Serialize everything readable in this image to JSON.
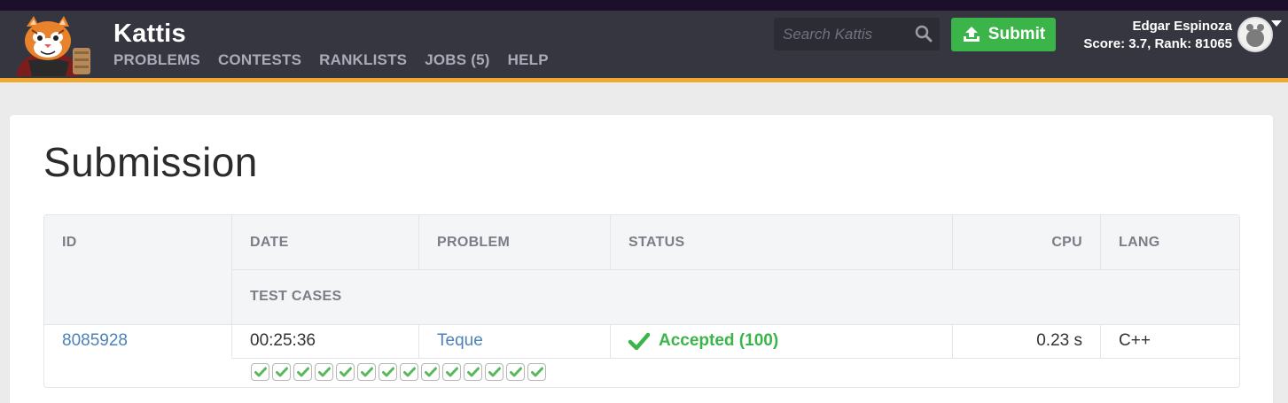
{
  "app": {
    "brand": "Kattis",
    "nav": [
      "PROBLEMS",
      "CONTESTS",
      "RANKLISTS",
      "JOBS (5)",
      "HELP"
    ],
    "search_placeholder": "Search Kattis",
    "submit_label": "Submit",
    "user_name": "Edgar Espinoza",
    "user_stats": "Score: 3.7, Rank: 81065"
  },
  "page": {
    "title": "Submission"
  },
  "table": {
    "headers": {
      "id": "ID",
      "date": "DATE",
      "problem": "PROBLEM",
      "status": "STATUS",
      "cpu": "CPU",
      "lang": "LANG",
      "test_cases": "TEST CASES"
    },
    "row": {
      "id": "8085928",
      "date": "00:25:36",
      "problem": "Teque",
      "status": "Accepted (100)",
      "cpu": "0.23 s",
      "lang": "C++",
      "test_cases_count": 14
    }
  },
  "colors": {
    "accent": "#3bb54a",
    "header_bg": "#363640",
    "header_border": "#f0a830",
    "link": "#4e82b8"
  }
}
